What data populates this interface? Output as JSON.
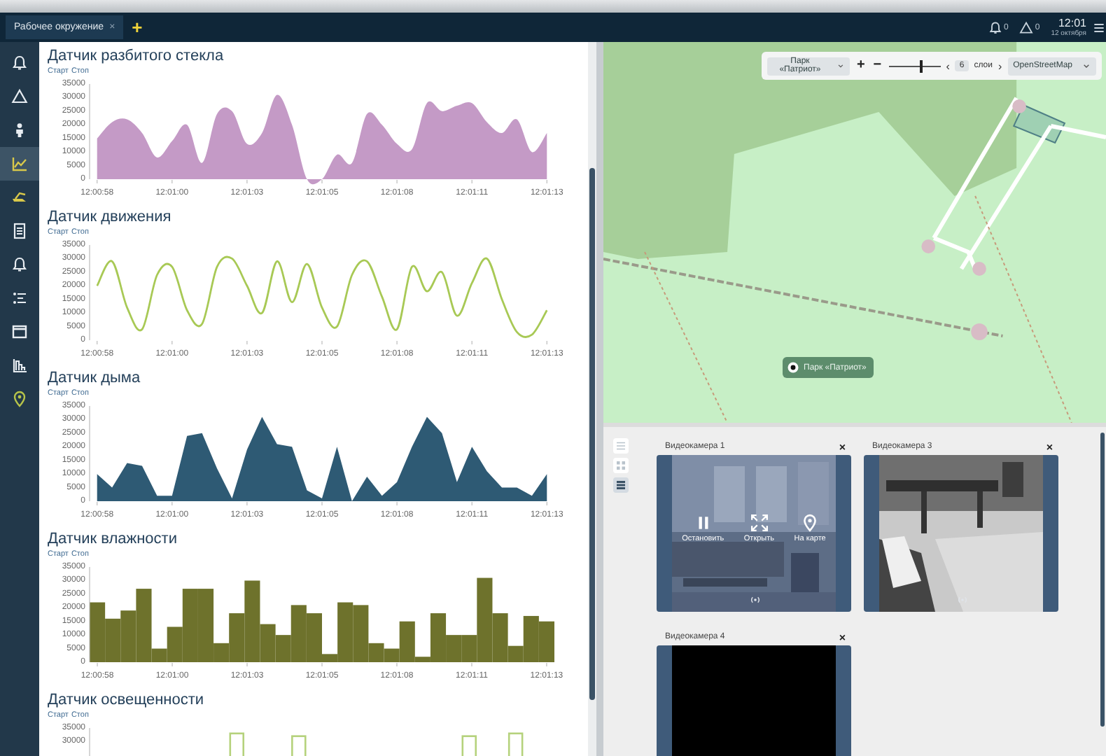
{
  "topbar": {
    "tabs": [
      {
        "label": "Рабочее окружение",
        "close": "×",
        "selected": true
      }
    ],
    "add": "+",
    "alerts": [
      {
        "kind": "bell",
        "count": "0"
      },
      {
        "kind": "warning",
        "count": "0"
      }
    ],
    "time": "12:01",
    "date": "12 октября"
  },
  "sidebar": {
    "items": [
      {
        "kind": "bell",
        "selected": false,
        "color": "#e8edf2"
      },
      {
        "kind": "warning",
        "selected": false,
        "color": "#e8edf2"
      },
      {
        "kind": "person",
        "selected": false,
        "color": "#e8edf2"
      },
      {
        "kind": "chart",
        "selected": true,
        "color": "#d8c84a"
      },
      {
        "kind": "lamp",
        "selected": false,
        "color": "#d8c84a"
      },
      {
        "kind": "doc",
        "selected": false,
        "color": "#e8edf2"
      },
      {
        "kind": "bell",
        "selected": false,
        "color": "#e8edf2"
      },
      {
        "kind": "list",
        "selected": false,
        "color": "#e8edf2"
      },
      {
        "kind": "window",
        "selected": false,
        "color": "#e8edf2"
      },
      {
        "kind": "barchart",
        "selected": false,
        "color": "#e8edf2"
      },
      {
        "kind": "pin",
        "selected": false,
        "color": "#b7c44a"
      }
    ]
  },
  "sensors": [
    {
      "title": "Датчик разбитого стекла",
      "links": [
        "Старт",
        "Стоп"
      ],
      "kind": "smooth",
      "time_labels": [
        "12:00:58",
        "12:01:00",
        "12:01:03",
        "12:01:05",
        "12:01:08",
        "12:01:11",
        "12:01:13"
      ],
      "chart_data": {
        "type": "area",
        "ylim": [
          0,
          35000
        ],
        "yticks": [
          0,
          5000,
          10000,
          15000,
          20000,
          25000,
          30000,
          35000
        ],
        "series": [
          {
            "color": "#c49ac6",
            "values": [
              15000,
              21000,
              22000,
              17000,
              8000,
              14000,
              20000,
              6000,
              24000,
              25000,
              13000,
              17000,
              31000,
              20000,
              0,
              0,
              9000,
              6000,
              24000,
              20000,
              13000,
              11000,
              28000,
              25000,
              27000,
              28000,
              21000,
              17000,
              22000,
              10000,
              17000
            ]
          }
        ]
      }
    },
    {
      "title": "Датчик движения",
      "links": [
        "Старт",
        "Стоп"
      ],
      "kind": "smooth",
      "time_labels": [
        "12:00:58",
        "12:01:00",
        "12:01:03",
        "12:01:05",
        "12:01:08",
        "12:01:11",
        "12:01:13"
      ],
      "chart_data": {
        "type": "line",
        "ylim": [
          0,
          35000
        ],
        "yticks": [
          0,
          5000,
          10000,
          15000,
          20000,
          25000,
          30000,
          35000
        ],
        "series": [
          {
            "color": "#a8c955",
            "values": [
              20000,
              29000,
              12000,
              4000,
              24000,
              27000,
              11000,
              6000,
              27000,
              30000,
              20000,
              10000,
              29000,
              14000,
              28000,
              12000,
              5000,
              24000,
              29000,
              16000,
              4000,
              27000,
              18000,
              25000,
              9000,
              21000,
              30000,
              15000,
              3000,
              2000,
              11000
            ]
          }
        ]
      }
    },
    {
      "title": "Датчик дыма",
      "links": [
        "Старт",
        "Стоп"
      ],
      "kind": "sharp",
      "time_labels": [
        "12:00:58",
        "12:01:00",
        "12:01:03",
        "12:01:05",
        "12:01:08",
        "12:01:11",
        "12:01:13"
      ],
      "chart_data": {
        "type": "area",
        "ylim": [
          0,
          35000
        ],
        "yticks": [
          0,
          5000,
          10000,
          15000,
          20000,
          25000,
          30000,
          35000
        ],
        "series": [
          {
            "color": "#2e5a74",
            "values": [
              10000,
              5000,
              14000,
              13000,
              2000,
              2000,
              24000,
              25000,
              12000,
              1000,
              19000,
              31000,
              21000,
              20000,
              4000,
              1000,
              20000,
              0,
              9000,
              2000,
              7000,
              20000,
              31000,
              25000,
              7000,
              20000,
              11000,
              5000,
              5000,
              2000,
              10000
            ]
          }
        ]
      }
    },
    {
      "title": "Датчик влажности",
      "links": [
        "Старт",
        "Стоп"
      ],
      "kind": "filled",
      "time_labels": [
        "12:00:58",
        "12:01:00",
        "12:01:03",
        "12:01:05",
        "12:01:08",
        "12:01:11",
        "12:01:13"
      ],
      "chart_data": {
        "type": "bar",
        "ylim": [
          0,
          35000
        ],
        "yticks": [
          0,
          5000,
          10000,
          15000,
          20000,
          25000,
          30000,
          35000
        ],
        "series": [
          {
            "color": "#6e722c",
            "values": [
              22000,
              16000,
              19000,
              27000,
              5000,
              13000,
              27000,
              27000,
              7000,
              18000,
              30000,
              14000,
              10000,
              21000,
              18000,
              3000,
              22000,
              21000,
              7000,
              5000,
              15000,
              2000,
              18000,
              10000,
              10000,
              31000,
              18000,
              6000,
              17000,
              15000
            ]
          }
        ]
      }
    },
    {
      "title": "Датчик освещенности",
      "links": [
        "Старт",
        "Стоп"
      ],
      "kind": "outline",
      "chart_data": {
        "type": "bar",
        "ylim": [
          0,
          35000
        ],
        "yticks": [
          30000,
          35000
        ],
        "series": [
          {
            "color": "#b5d27c",
            "values": [
              null,
              null,
              null,
              null,
              null,
              null,
              null,
              null,
              null,
              33000,
              null,
              null,
              null,
              32000,
              null,
              null,
              null,
              null,
              null,
              null,
              null,
              null,
              null,
              null,
              32000,
              null,
              null,
              33000,
              null,
              null
            ]
          }
        ]
      }
    }
  ],
  "map": {
    "kind": "picture",
    "place_select": "Парк «Патриот»",
    "zoom_in": "+",
    "zoom_out": "−",
    "zoom": {
      "level": 0.62
    },
    "prev": "‹",
    "page": "6",
    "layers": "слои",
    "next": "›",
    "layer_select": "OpenStreetMap",
    "marker": "Парк «Патриот»"
  },
  "cameras": {
    "layouts": [
      {
        "kind": "list",
        "selected": false
      },
      {
        "kind": "grid",
        "selected": false
      },
      {
        "kind": "rows",
        "selected": true
      }
    ],
    "tiles": [
      {
        "title": "Видеокамера 1",
        "close": "×",
        "kind": "office",
        "actions": [
          {
            "kind": "pause",
            "label": "Остановить"
          },
          {
            "kind": "expand",
            "label": "Открыть"
          },
          {
            "kind": "pin",
            "label": "На карте"
          }
        ]
      },
      {
        "title": "Видеокамера 3",
        "close": "×",
        "kind": "room"
      },
      {
        "title": "Видеокамера 4",
        "close": "×",
        "kind": "blank"
      }
    ]
  }
}
